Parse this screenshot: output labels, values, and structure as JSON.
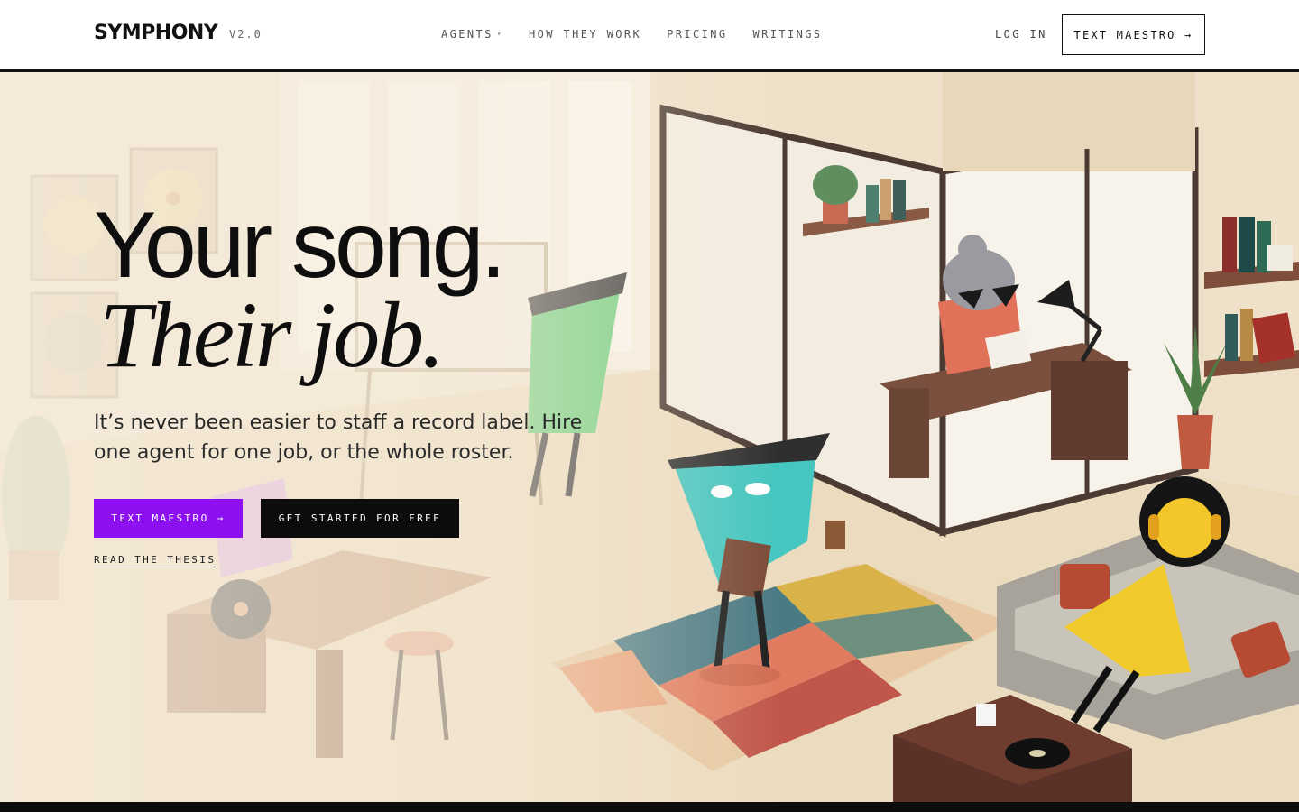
{
  "header": {
    "logo": "SYMPHONY",
    "version": "V2.0",
    "nav": [
      {
        "label": "AGENTS",
        "has_dropdown": true
      },
      {
        "label": "HOW THEY WORK"
      },
      {
        "label": "PRICING"
      },
      {
        "label": "WRITINGS"
      }
    ],
    "login_label": "LOG IN",
    "cta_label": "TEXT MAESTRO →"
  },
  "hero": {
    "headline_line1": "Your song.",
    "headline_line2": "Their job.",
    "subhead": "It’s never been easier to staff a record label. Hire one agent for one job, or the whole roster.",
    "primary_button": "TEXT MAESTRO →",
    "secondary_button": "GET STARTED FOR FREE",
    "thesis_link": "READ THE THESIS",
    "illustration": "record-label-office-illustration",
    "colors": {
      "accent_purple": "#8c10f0",
      "button_dark": "#0c0c0c",
      "hero_bg": "#f4ead9"
    }
  }
}
